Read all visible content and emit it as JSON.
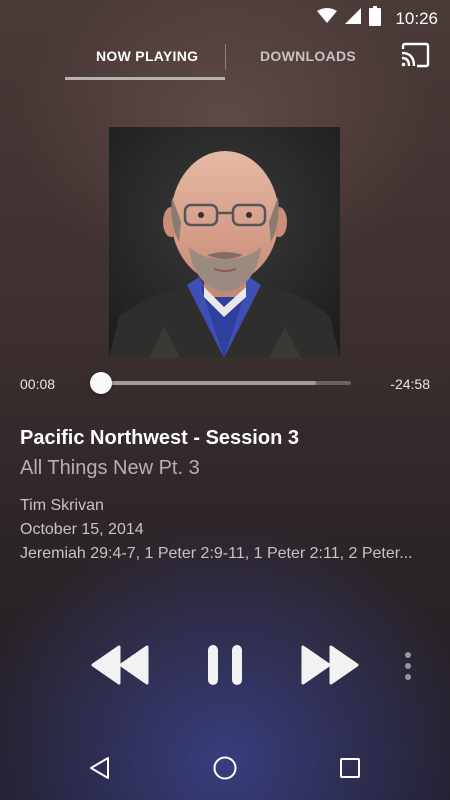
{
  "status": {
    "time": "10:26"
  },
  "tabs": [
    {
      "label": "NOW PLAYING"
    },
    {
      "label": "DOWNLOADS"
    }
  ],
  "player": {
    "elapsed": "00:08",
    "remaining": "-24:58",
    "progress_fraction": 0.005,
    "buffered_fraction": 0.86
  },
  "episode": {
    "title": "Pacific Northwest - Session 3",
    "subtitle": "All Things New Pt. 3",
    "speaker": "Tim Skrivan",
    "date": "October 15, 2014",
    "scripture": "Jeremiah 29:4-7, 1 Peter 2:9-11, 1 Peter 2:11, 2 Peter..."
  },
  "icons": {
    "cast": "cast-icon",
    "rewind": "rewind-icon",
    "pause": "pause-icon",
    "forward": "fast-forward-icon",
    "more": "more-vert-icon",
    "back": "nav-back-icon",
    "home": "nav-home-icon",
    "recent": "nav-recent-apps-icon"
  },
  "colors": {
    "text_primary": "#ffffff",
    "text_secondary": "#b8b0b0",
    "controls": "#f2f2f2"
  }
}
